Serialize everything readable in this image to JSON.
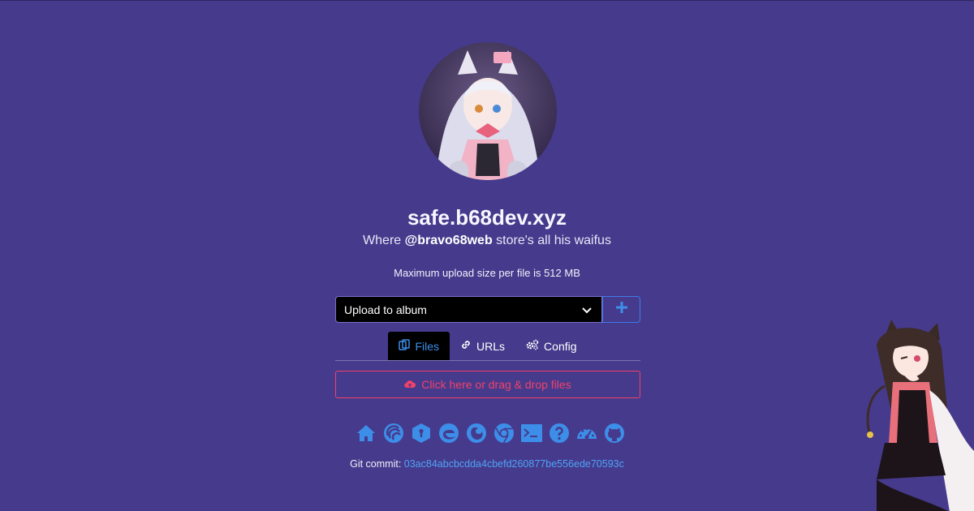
{
  "site": {
    "title": "safe.b68dev.xyz",
    "subtitle_prefix": "Where ",
    "subtitle_user": "@bravo68web",
    "subtitle_suffix": " store's all his waifus",
    "max_upload": "Maximum upload size per file is 512 MB"
  },
  "album": {
    "selected": "Upload to album",
    "add_icon": "plus-icon"
  },
  "tabs": [
    {
      "label": "Files",
      "icon": "files-icon",
      "active": true
    },
    {
      "label": "URLs",
      "icon": "link-icon",
      "active": false
    },
    {
      "label": "Config",
      "icon": "cogs-icon",
      "active": false
    }
  ],
  "dropzone": {
    "label": "Click here or drag & drop files",
    "icon": "cloud-upload-icon"
  },
  "links": [
    "home-icon",
    "sharex-icon",
    "privacy-icon",
    "edge-icon",
    "firefox-icon",
    "chrome-icon",
    "terminal-icon",
    "help-icon",
    "dashboard-icon",
    "github-icon"
  ],
  "footer": {
    "commit_label": "Git commit: ",
    "commit_hash": "03ac84abcbcdda4cbefd260877be556ede70593c"
  },
  "colors": {
    "background": "#463a8c",
    "accent_blue": "#3d8ee8",
    "danger": "#f0426a"
  }
}
